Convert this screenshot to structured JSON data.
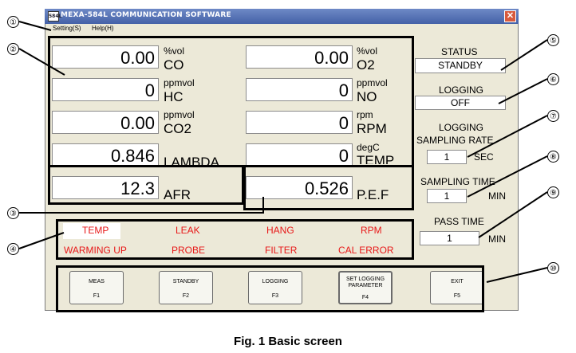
{
  "window": {
    "title": "MEXA-584L COMMUNICATION SOFTWARE",
    "icon_text": "584L",
    "close_symbol": "✕"
  },
  "menu": {
    "items": [
      "Setting(S)",
      "Help(H)"
    ]
  },
  "measurements": [
    {
      "value": "0.00",
      "unit": "%vol",
      "name": "CO"
    },
    {
      "value": "0.00",
      "unit": "%vol",
      "name": "O2"
    },
    {
      "value": "0",
      "unit": "ppmvol",
      "name": "HC"
    },
    {
      "value": "0",
      "unit": "ppmvol",
      "name": "NO"
    },
    {
      "value": "0.00",
      "unit": "ppmvol",
      "name": "CO2"
    },
    {
      "value": "0",
      "unit": "rpm",
      "name": "RPM"
    },
    {
      "value": "0.846",
      "unit": "",
      "name": "LAMBDA"
    },
    {
      "value": "0",
      "unit": "degC",
      "name": "TEMP"
    },
    {
      "value": "12.3",
      "unit": "",
      "name": "AFR"
    },
    {
      "value": "0.526",
      "unit": "",
      "name": "P.E.F"
    }
  ],
  "status": {
    "status_label": "STATUS",
    "status_value": "STANDBY",
    "logging_label": "LOGGING",
    "logging_value": "OFF",
    "rate_label_1": "LOGGING",
    "rate_label_2": "SAMPLING RATE",
    "rate_value": "1",
    "rate_unit": "SEC",
    "time_label": "SAMPLING TIME",
    "time_value": "1",
    "time_unit": "MIN",
    "pass_label": "PASS TIME",
    "pass_value": "1",
    "pass_unit": "MIN"
  },
  "alarms": {
    "row1": [
      "TEMP",
      "LEAK",
      "HANG",
      "RPM"
    ],
    "row2": [
      "WARMING UP",
      "PROBE",
      "FILTER",
      "CAL ERROR"
    ],
    "color": "#e81818"
  },
  "buttons": [
    {
      "label": "MEAS",
      "key": "F1"
    },
    {
      "label": "STANDBY",
      "key": "F2"
    },
    {
      "label": "LOGGING",
      "key": "F3"
    },
    {
      "label": "SET LOGGING PARAMETER",
      "key": "F4"
    },
    {
      "label": "EXIT",
      "key": "F5"
    }
  ],
  "callouts": [
    "①",
    "②",
    "③",
    "④",
    "⑤",
    "⑥",
    "⑦",
    "⑧",
    "⑨",
    "⑩"
  ],
  "caption": "Fig. 1  Basic screen"
}
